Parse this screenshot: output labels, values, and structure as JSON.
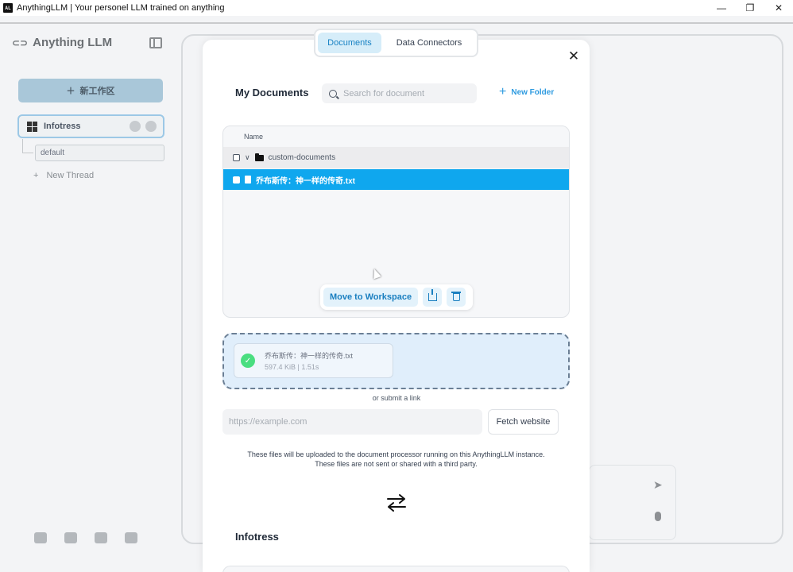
{
  "window": {
    "title": "AnythingLLM | Your personel LLM trained on anything",
    "app_icon": "AL",
    "minimize": "—",
    "restore": "❐",
    "close": "✕"
  },
  "sidebar": {
    "logo_mark": "⊂⊃",
    "logo_text": "Anything LLM",
    "new_workspace_label": "新工作区",
    "workspace_name": "Infotress",
    "thread_name": "default",
    "new_thread_label": "New Thread"
  },
  "modal": {
    "tabs": [
      {
        "label": "Documents",
        "active": true
      },
      {
        "label": "Data Connectors",
        "active": false
      }
    ],
    "close_icon": "✕",
    "my_documents_title": "My Documents",
    "search_placeholder": "Search for document",
    "new_folder_label": "New Folder",
    "file_table": {
      "column_name": "Name",
      "folder_name": "custom-documents",
      "selected_file": "乔布斯传：神一样的传奇.txt"
    },
    "actions": {
      "move_to_workspace": "Move to Workspace"
    },
    "upload": {
      "file_name": "乔布斯传：神一样的传奇.txt",
      "file_meta": "597.4 KiB | 1.51s"
    },
    "or_submit_link": "or submit a link",
    "url_placeholder": "https://example.com",
    "fetch_button": "Fetch website",
    "notice_line1": "These files will be uploaded to the document processor running on this AnythingLLM instance.",
    "notice_line2": "These files are not sent or shared with a third party.",
    "workspace_title": "Infotress"
  },
  "colors": {
    "accent": "#0fa7ee",
    "dropzone_bg": "#e0eefb",
    "success": "#4ade80"
  }
}
